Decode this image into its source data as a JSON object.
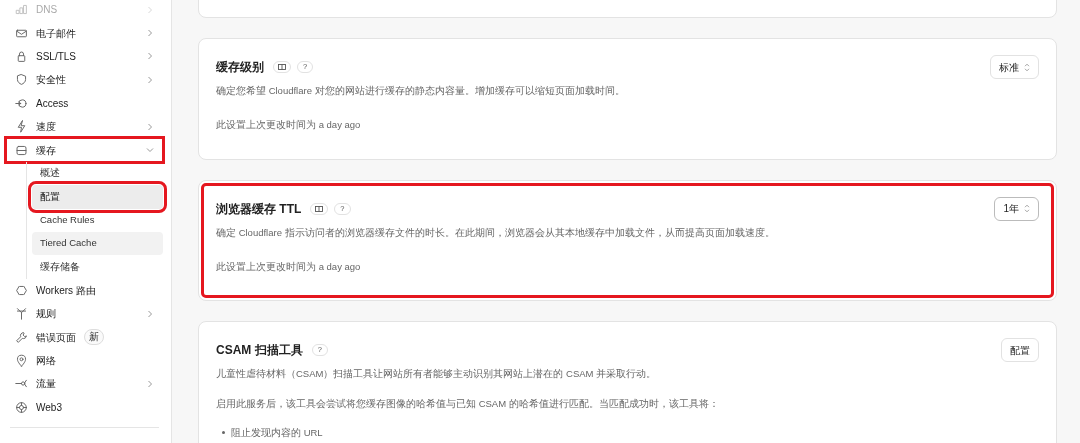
{
  "sidebar": {
    "items": [
      {
        "label": "DNS",
        "has_submenu": true,
        "faded": true,
        "highlighted": false
      },
      {
        "label": "电子邮件",
        "has_submenu": true,
        "faded": false,
        "highlighted": false
      },
      {
        "label": "SSL/TLS",
        "has_submenu": true,
        "faded": false,
        "highlighted": false
      },
      {
        "label": "安全性",
        "has_submenu": true,
        "faded": false,
        "highlighted": false
      },
      {
        "label": "Access",
        "has_submenu": false,
        "faded": false,
        "highlighted": false
      },
      {
        "label": "速度",
        "has_submenu": true,
        "faded": false,
        "highlighted": false
      },
      {
        "label": "缓存",
        "has_submenu": true,
        "faded": false,
        "highlighted": true,
        "expanded": true,
        "children": [
          {
            "label": "概述",
            "selected": false,
            "hovered": false,
            "highlighted": false
          },
          {
            "label": "配置",
            "selected": true,
            "hovered": false,
            "highlighted": true
          },
          {
            "label": "Cache Rules",
            "selected": false,
            "hovered": false,
            "highlighted": false
          },
          {
            "label": "Tiered Cache",
            "selected": false,
            "hovered": true,
            "highlighted": false
          },
          {
            "label": "缓存储备",
            "selected": false,
            "hovered": false,
            "highlighted": false
          }
        ]
      },
      {
        "label": "Workers 路由",
        "has_submenu": false,
        "faded": false,
        "highlighted": false
      },
      {
        "label": "规则",
        "has_submenu": true,
        "faded": false,
        "highlighted": false
      },
      {
        "label": "错误页面",
        "badge": "新",
        "has_submenu": false,
        "faded": false,
        "highlighted": false
      },
      {
        "label": "网络",
        "has_submenu": false,
        "faded": false,
        "highlighted": false
      },
      {
        "label": "流量",
        "has_submenu": true,
        "faded": false,
        "highlighted": false
      },
      {
        "label": "Web3",
        "has_submenu": false,
        "faded": false,
        "highlighted": false
      }
    ]
  },
  "cards": [
    {
      "title": "缓存级别",
      "docs_icon": true,
      "help": "?",
      "description": "确定您希望 Cloudflare 对您的网站进行缓存的静态内容量。增加缓存可以缩短页面加载时间。",
      "footnote": "此设置上次更改时间为 a day ago",
      "control": {
        "kind": "select",
        "value": "标准"
      },
      "highlighted": false
    },
    {
      "title": "浏览器缓存 TTL",
      "docs_icon": true,
      "help": "?",
      "description": "确定 Cloudflare 指示访问者的浏览器缓存文件的时长。在此期间，浏览器会从其本地缓存中加载文件，从而提高页面加载速度。",
      "footnote": "此设置上次更改时间为 a day ago",
      "control": {
        "kind": "select",
        "value": "1年"
      },
      "highlighted": true
    },
    {
      "title": "CSAM 扫描工具",
      "docs_icon": false,
      "help": "?",
      "description": "儿童性虐待材料（CSAM）扫描工具让网站所有者能够主动识别其网站上潜在的 CSAM 并采取行动。",
      "paragraph": "启用此服务后，该工具会尝试将您缓存图像的哈希值与已知 CSAM 的哈希值进行匹配。当匹配成功时，该工具将：",
      "bullets": [
        "阻止发现内容的 URL"
      ],
      "control": {
        "kind": "button",
        "value": "配置"
      },
      "highlighted": false
    }
  ]
}
